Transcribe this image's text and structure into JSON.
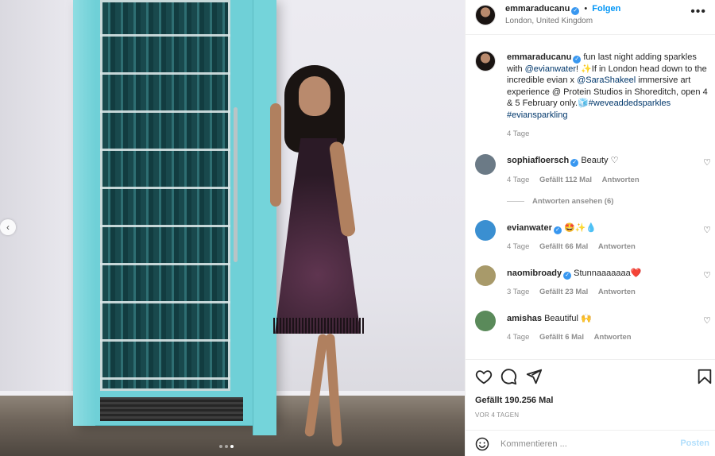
{
  "post": {
    "username": "emmaraducanu",
    "follow_label": "Folgen",
    "location": "London, United Kingdom",
    "more": "•••"
  },
  "caption": {
    "username": "emmaraducanu",
    "parts": {
      "a": "fun last night adding sparkles with ",
      "mention1": "@evianwater",
      "b": "! ✨If in London head down to the incredible evian x ",
      "mention2": "@SaraShakeel",
      "c": " immersive art experience @ Protein Studios in Shoreditch, open 4 & 5 February only.🧊",
      "tag1": "#weveaddedsparkles",
      "tag2": "#eviansparkling"
    },
    "time": "4 Tage"
  },
  "comments": [
    {
      "username": "sophiafloersch",
      "text": "Beauty ♡",
      "time": "4 Tage",
      "likes": "Gefällt 112 Mal",
      "reply": "Antworten",
      "view_replies": "Antworten ansehen (6)",
      "avatar_color": "#6b7a86"
    },
    {
      "username": "evianwater",
      "text": "🤩✨💧",
      "time": "4 Tage",
      "likes": "Gefällt 66 Mal",
      "reply": "Antworten",
      "avatar_color": "#3a8fd1"
    },
    {
      "username": "naomibroady",
      "text": "Stunnaaaaaaa❤️",
      "time": "3 Tage",
      "likes": "Gefällt 23 Mal",
      "reply": "Antworten",
      "avatar_color": "#a89a6a"
    },
    {
      "username": "amishas",
      "text": "Beautiful 🙌",
      "time": "4 Tage",
      "likes": "Gefällt 6 Mal",
      "reply": "Antworten",
      "avatar_color": "#5a8a5a"
    }
  ],
  "actions": {
    "likes": "Gefällt 190.256 Mal",
    "posted": "VOR 4 TAGEN"
  },
  "comment_box": {
    "placeholder": "Kommentieren ...",
    "post_label": "Posten"
  },
  "carousel": {
    "current": 3,
    "total": 3
  },
  "colors": {
    "link": "#00376b",
    "accent": "#0095f6",
    "verified": "#3897f0",
    "fridge": "#6fd0d7"
  },
  "icons": [
    "chevron-left-icon",
    "heart-icon",
    "comment-icon",
    "share-icon",
    "bookmark-icon",
    "emoji-icon",
    "more-icon",
    "verified-icon"
  ]
}
